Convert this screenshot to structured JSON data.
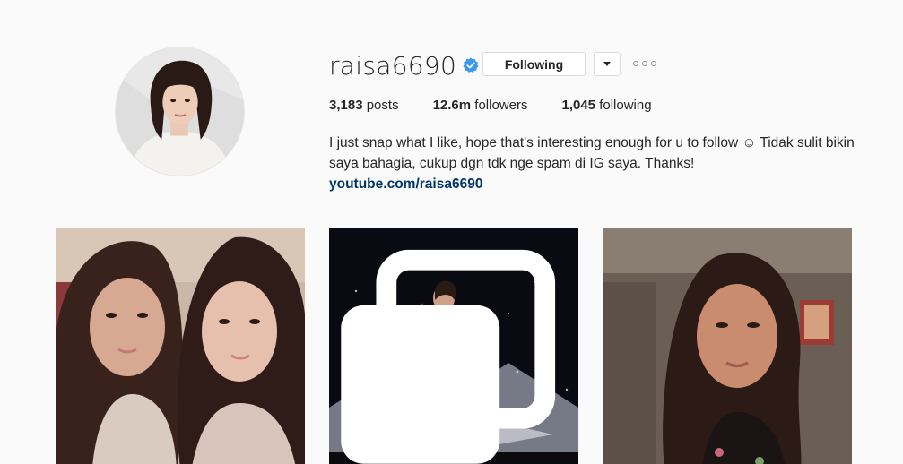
{
  "profile": {
    "username": "raisa6690",
    "verified": true,
    "follow_button_label": "Following",
    "stats": {
      "posts_count": "3,183",
      "posts_label": "posts",
      "followers_count": "12.6m",
      "followers_label": "followers",
      "following_count": "1,045",
      "following_label": "following"
    },
    "bio": "I just snap what I like, hope that's interesting enough for u to follow ☺ Tidak sulit bikin saya bahagia, cukup dgn tdk nge spam di IG saya. Thanks!",
    "link": "youtube.com/raisa6690"
  },
  "colors": {
    "background": "#fafafa",
    "link": "#003569",
    "verified": "#3897f0",
    "border": "#dbdbdb"
  },
  "icons": {
    "verified": "verified-badge-icon",
    "dropdown": "chevron-down-icon",
    "more": "more-options-icon",
    "multi": "multiple-photos-icon"
  }
}
